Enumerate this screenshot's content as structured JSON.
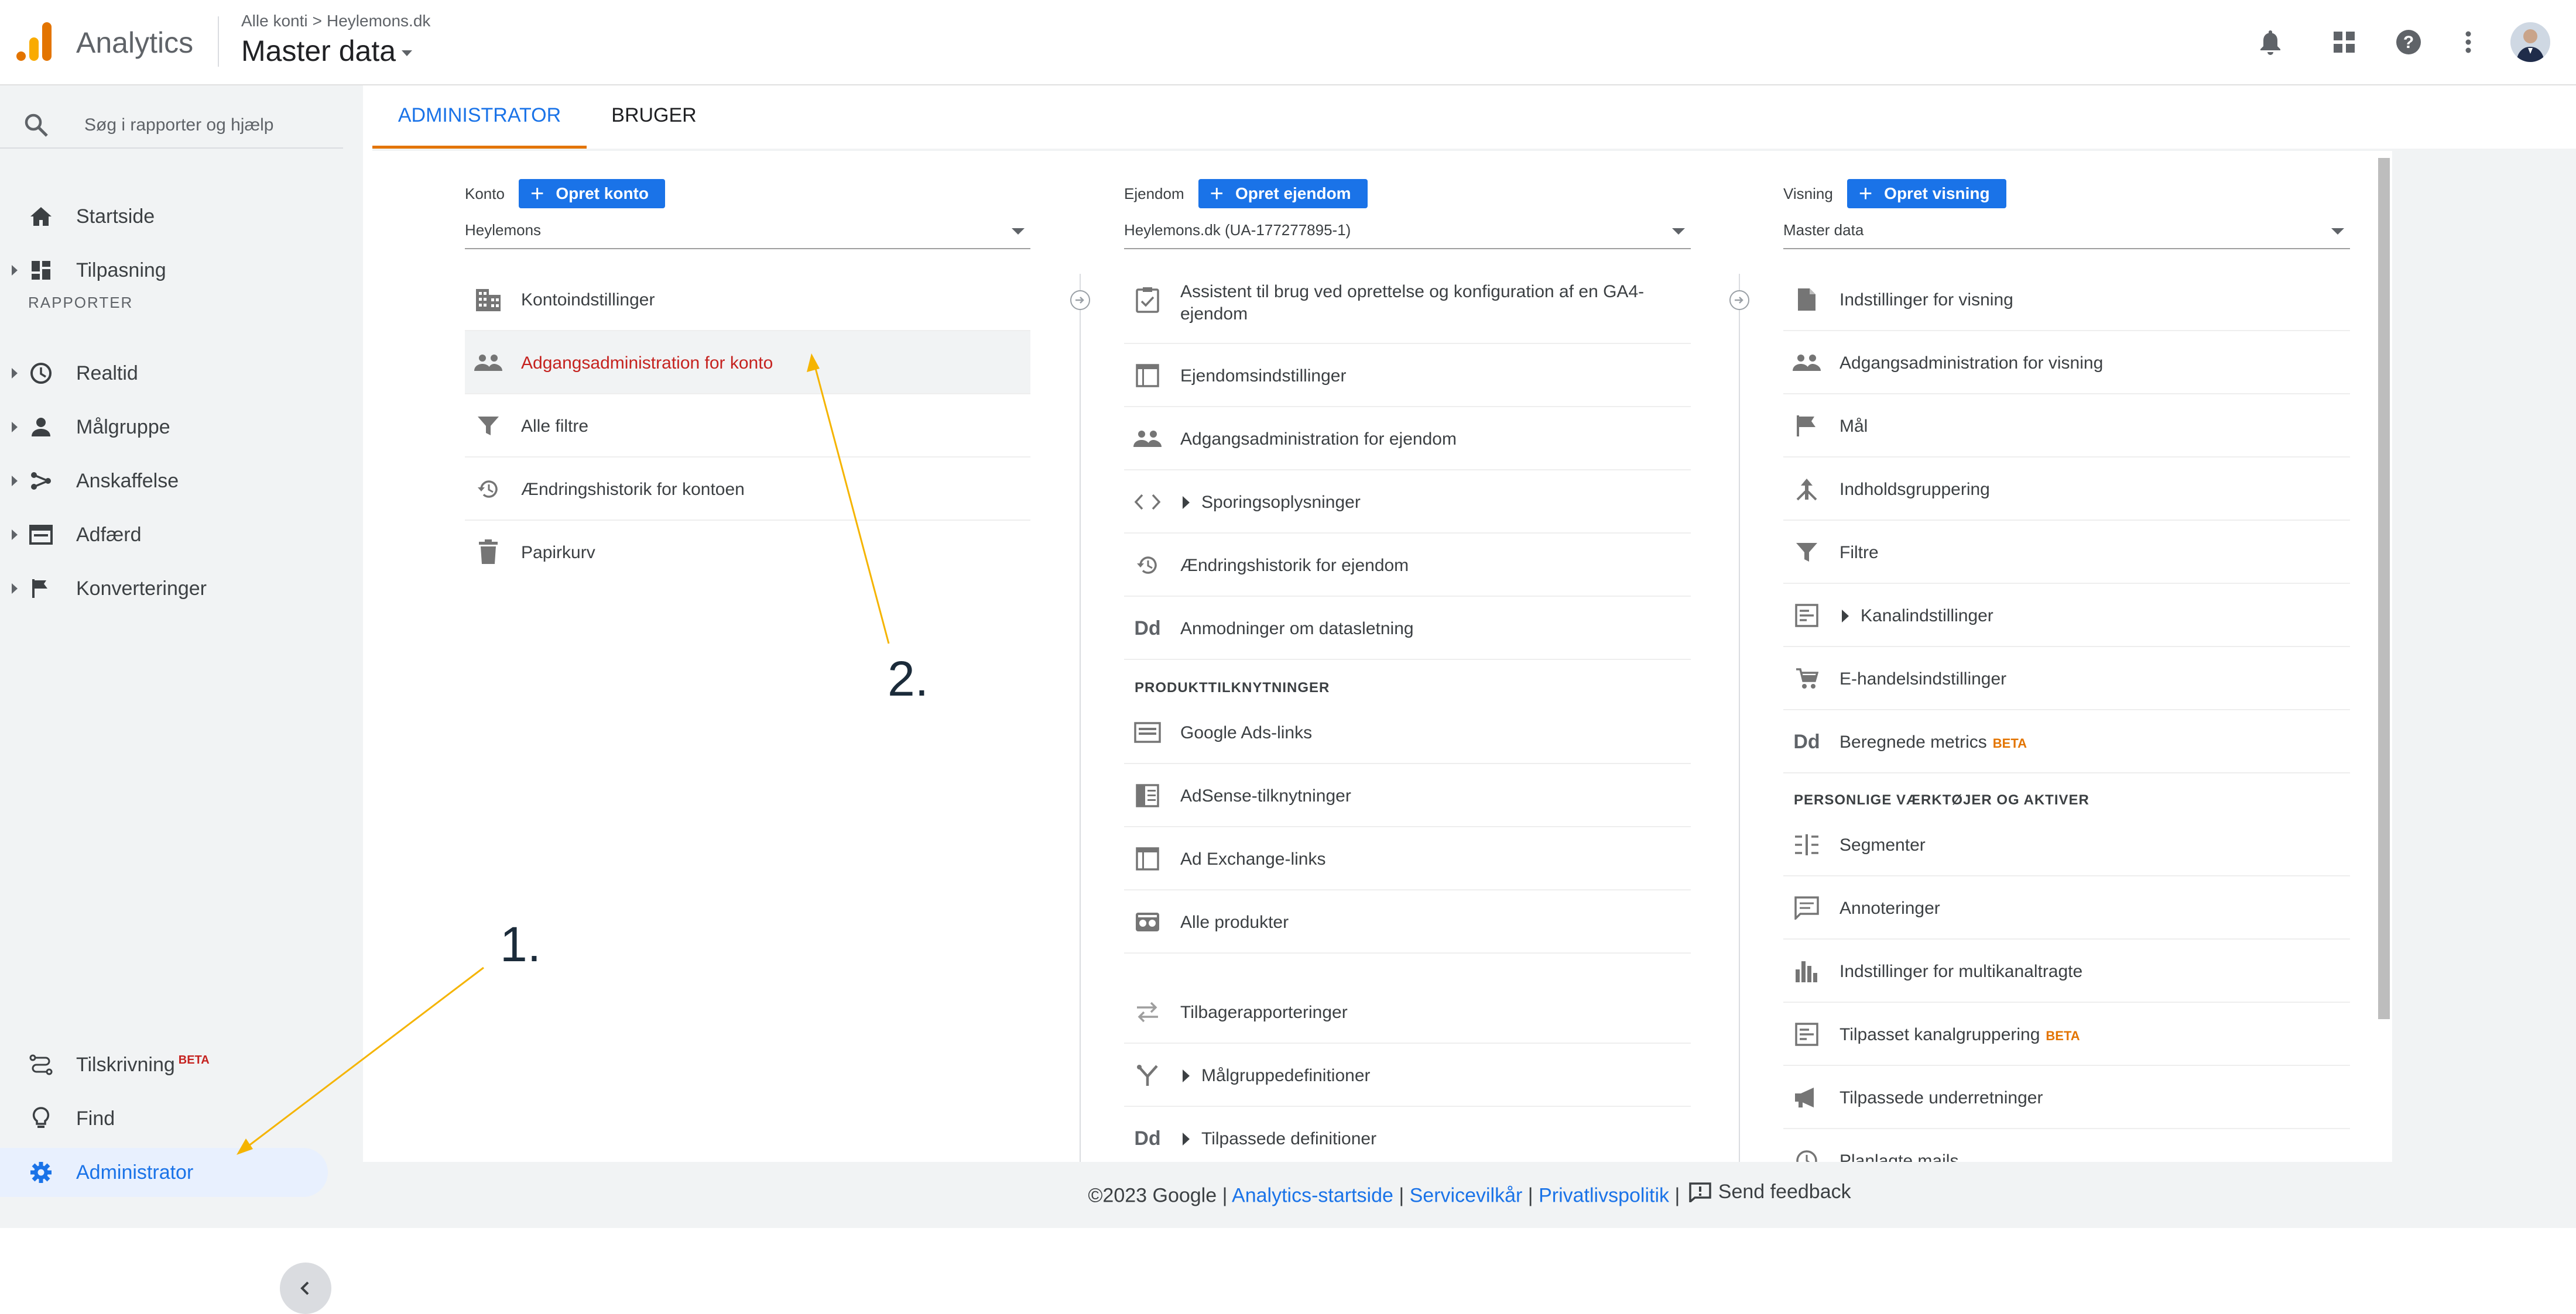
{
  "app": {
    "name": "Analytics"
  },
  "breadcrumb": {
    "account_level": "Alle konti",
    "account": "Heylemons.dk"
  },
  "header": {
    "view_title": "Master data"
  },
  "sidebar": {
    "search_placeholder": "Søg i rapporter og hjælp",
    "items_top": [
      {
        "label": "Startside",
        "icon": "home-icon"
      },
      {
        "label": "Tilpasning",
        "icon": "dashboard-icon"
      }
    ],
    "section_label": "RAPPORTER",
    "reports": [
      {
        "label": "Realtid",
        "icon": "clock-icon"
      },
      {
        "label": "Målgruppe",
        "icon": "person-icon"
      },
      {
        "label": "Anskaffelse",
        "icon": "acquisition-icon"
      },
      {
        "label": "Adfærd",
        "icon": "behavior-icon"
      },
      {
        "label": "Konverteringer",
        "icon": "flag-icon"
      }
    ],
    "bottom": [
      {
        "label": "Tilskrivning",
        "badge": "BETA",
        "icon": "attribution-icon"
      },
      {
        "label": "Find",
        "icon": "lightbulb-icon"
      },
      {
        "label": "Administrator",
        "icon": "gear-icon"
      }
    ]
  },
  "tabs": {
    "admin": "ADMINISTRATOR",
    "user": "BRUGER"
  },
  "account_col": {
    "heading": "Konto",
    "button": "Opret konto",
    "selected": "Heylemons",
    "items": [
      {
        "label": "Kontoindstillinger",
        "icon": "building-icon"
      },
      {
        "label": "Adgangsadministration for konto",
        "icon": "people-icon"
      },
      {
        "label": "Alle filtre",
        "icon": "filter-icon"
      },
      {
        "label": "Ændringshistorik for kontoen",
        "icon": "history-icon"
      },
      {
        "label": "Papirkurv",
        "icon": "trash-icon"
      }
    ]
  },
  "property_col": {
    "heading": "Ejendom",
    "button": "Opret ejendom",
    "selected": "Heylemons.dk (UA-177277895-1)",
    "items": [
      {
        "label": "Assistent til brug ved oprettelse og konfiguration af en GA4-ejendom",
        "icon": "checklist-icon"
      },
      {
        "label": "Ejendomsindstillinger",
        "icon": "property-settings-icon"
      },
      {
        "label": "Adgangsadministration for ejendom",
        "icon": "people-icon"
      },
      {
        "label": "Sporingsoplysninger",
        "icon": "code-icon"
      },
      {
        "label": "Ændringshistorik for ejendom",
        "icon": "history-icon"
      },
      {
        "label": "Anmodninger om datasletning",
        "icon": "data-deletion-icon",
        "icon_text": "Dd"
      }
    ],
    "section": "PRODUKTTILKNYTNINGER",
    "links": [
      {
        "label": "Google Ads-links",
        "icon": "ads-icon"
      },
      {
        "label": "AdSense-tilknytninger",
        "icon": "adsense-icon"
      },
      {
        "label": "Ad Exchange-links",
        "icon": "ad-exchange-icon"
      },
      {
        "label": "Alle produkter",
        "icon": "products-icon"
      }
    ],
    "more": [
      {
        "label": "Tilbagerapporteringer",
        "icon": "postbacks-icon"
      },
      {
        "label": "Målgruppedefinitioner",
        "icon": "audience-def-icon"
      },
      {
        "label": "Tilpassede definitioner",
        "icon": "custom-def-icon",
        "icon_text": "Dd"
      }
    ]
  },
  "view_col": {
    "heading": "Visning",
    "button": "Opret visning",
    "selected": "Master data",
    "items": [
      {
        "label": "Indstillinger for visning",
        "icon": "document-icon"
      },
      {
        "label": "Adgangsadministration for visning",
        "icon": "people-icon"
      },
      {
        "label": "Mål",
        "icon": "flag-icon"
      },
      {
        "label": "Indholdsgruppering",
        "icon": "content-grouping-icon"
      },
      {
        "label": "Filtre",
        "icon": "filter-icon"
      },
      {
        "label": "Kanalindstillinger",
        "icon": "channel-icon"
      },
      {
        "label": "E-handelsindstillinger",
        "icon": "cart-icon"
      },
      {
        "label": "Beregnede metrics",
        "badge": "BETA",
        "icon": "calculated-metrics-icon",
        "icon_text": "Dd"
      }
    ],
    "section": "PERSONLIGE VÆRKTØJER OG AKTIVER",
    "tools": [
      {
        "label": "Segmenter",
        "icon": "segments-icon"
      },
      {
        "label": "Annoteringer",
        "icon": "comment-icon"
      },
      {
        "label": "Indstillinger for multikanaltragte",
        "icon": "bar-chart-icon"
      },
      {
        "label": "Tilpasset kanalgruppering",
        "badge": "BETA",
        "icon": "channel-icon"
      },
      {
        "label": "Tilpassede underretninger",
        "icon": "megaphone-icon"
      },
      {
        "label": "Planlagte mails",
        "icon": "mail-icon"
      }
    ]
  },
  "footer": {
    "copyright": "©2023 Google",
    "links": [
      "Analytics-startside",
      "Servicevilkår",
      "Privatlivspolitik"
    ],
    "feedback": "Send feedback"
  },
  "annotations": {
    "step1": "1.",
    "step2": "2."
  },
  "colors": {
    "accent": "#1a73e8",
    "annotation_arrow": "#f5b400",
    "selected_text": "#c5221f"
  }
}
